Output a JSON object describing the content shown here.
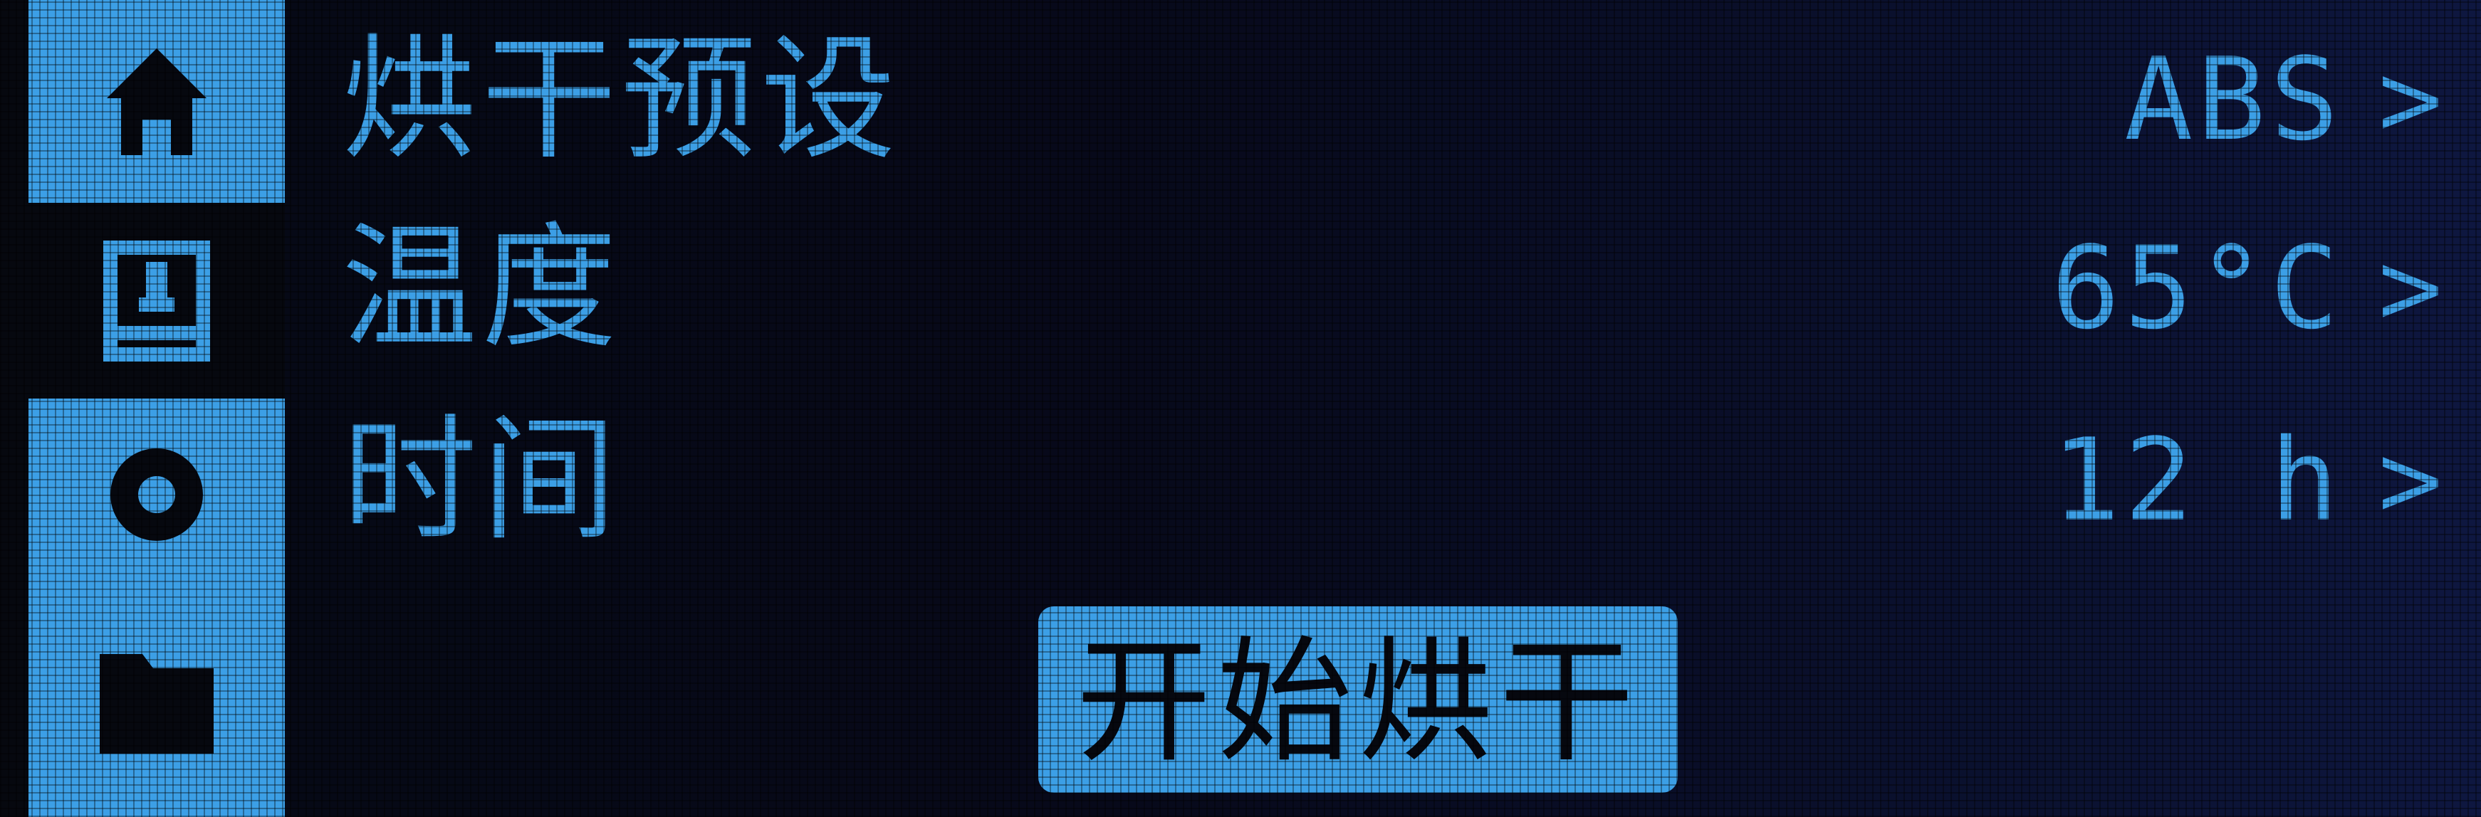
{
  "sidebar": {
    "tabs": [
      {
        "name": "home",
        "icon": "home-icon",
        "active": true
      },
      {
        "name": "drying",
        "icon": "dryer-box-icon",
        "active": false
      },
      {
        "name": "settings",
        "icon": "gear-icon",
        "active": true
      },
      {
        "name": "files",
        "icon": "folder-icon",
        "active": true
      }
    ]
  },
  "menu": {
    "preset": {
      "label": "烘干预设",
      "value": "ABS",
      "chevron": ">"
    },
    "temperature": {
      "label": "温度",
      "value": "65°C",
      "chevron": ">"
    },
    "time": {
      "label": "时间",
      "value": "12 h",
      "chevron": ">"
    }
  },
  "start_button": {
    "label": "开始烘干"
  },
  "colors": {
    "accent": "#3c9fe6",
    "background": "#06080f"
  }
}
